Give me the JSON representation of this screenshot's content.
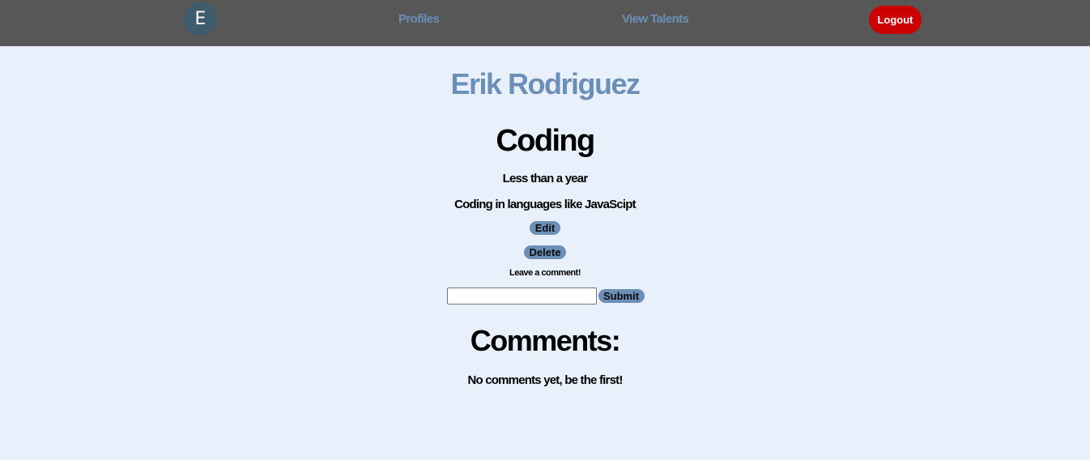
{
  "nav": {
    "avatar_letter": "E",
    "profiles_label": "Profiles",
    "talents_label": "View Talents",
    "logout_label": "Logout"
  },
  "talent": {
    "owner_name": "Erik Rodriguez",
    "title": "Coding",
    "experience": "Less than a year",
    "description": "Coding in languages like JavaScipt",
    "edit_label": "Edit",
    "delete_label": "Delete"
  },
  "comment_form": {
    "prompt": "Leave a comment!",
    "input_value": "",
    "submit_label": "Submit"
  },
  "comments": {
    "heading": "Comments:",
    "empty_message": "No comments yet, be the first!"
  },
  "colors": {
    "navbar": "#575757",
    "accent": "#6b8fb7",
    "logout": "#cc0000",
    "background": "#e8f0fb"
  }
}
